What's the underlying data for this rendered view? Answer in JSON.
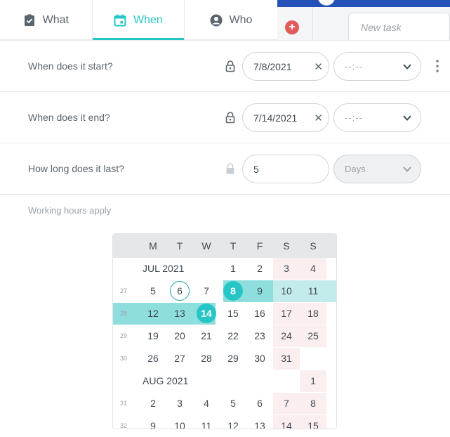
{
  "tabs": [
    {
      "label": "What",
      "icon": "clipboard-check-icon",
      "active": false
    },
    {
      "label": "When",
      "icon": "calendar-icon",
      "active": true
    },
    {
      "label": "Who",
      "icon": "user-circle-icon",
      "active": false
    }
  ],
  "background": {
    "new_task_placeholder": "New task",
    "add_icon": "plus-circle-icon"
  },
  "rows": {
    "start": {
      "label": "When does it start?",
      "date": "7/8/2021",
      "time_placeholder": "--:--"
    },
    "end": {
      "label": "When does it end?",
      "date": "7/14/2021",
      "time_placeholder": "--:--"
    },
    "duration": {
      "label": "How long does it last?",
      "value": "5",
      "unit": "Days"
    }
  },
  "working_hours": "Working hours apply",
  "calendar": {
    "weekdays": [
      "M",
      "T",
      "W",
      "T",
      "F",
      "S",
      "S"
    ],
    "months": [
      "JUL 2021",
      "AUG 2021"
    ],
    "weeks": [
      {
        "num": "",
        "days": [
          "",
          "",
          "",
          "1",
          "2",
          "3",
          "4"
        ]
      },
      {
        "num": "27",
        "days": [
          "5",
          "6",
          "7",
          "8",
          "9",
          "10",
          "11"
        ]
      },
      {
        "num": "28",
        "days": [
          "12",
          "13",
          "14",
          "15",
          "16",
          "17",
          "18"
        ]
      },
      {
        "num": "29",
        "days": [
          "19",
          "20",
          "21",
          "22",
          "23",
          "24",
          "25"
        ]
      },
      {
        "num": "30",
        "days": [
          "26",
          "27",
          "28",
          "29",
          "30",
          "31",
          ""
        ]
      },
      {
        "num": "",
        "days": [
          "",
          "",
          "",
          "",
          "",
          "",
          "1"
        ]
      },
      {
        "num": "31",
        "days": [
          "2",
          "3",
          "4",
          "5",
          "6",
          "7",
          "8"
        ]
      },
      {
        "num": "32",
        "days": [
          "9",
          "10",
          "11",
          "12",
          "13",
          "14",
          "15"
        ]
      }
    ]
  },
  "colors": {
    "accent": "#26c6c6",
    "range": "#c3ebeb",
    "weekend": "#fbeeee",
    "header_blue": "#2451b7"
  }
}
